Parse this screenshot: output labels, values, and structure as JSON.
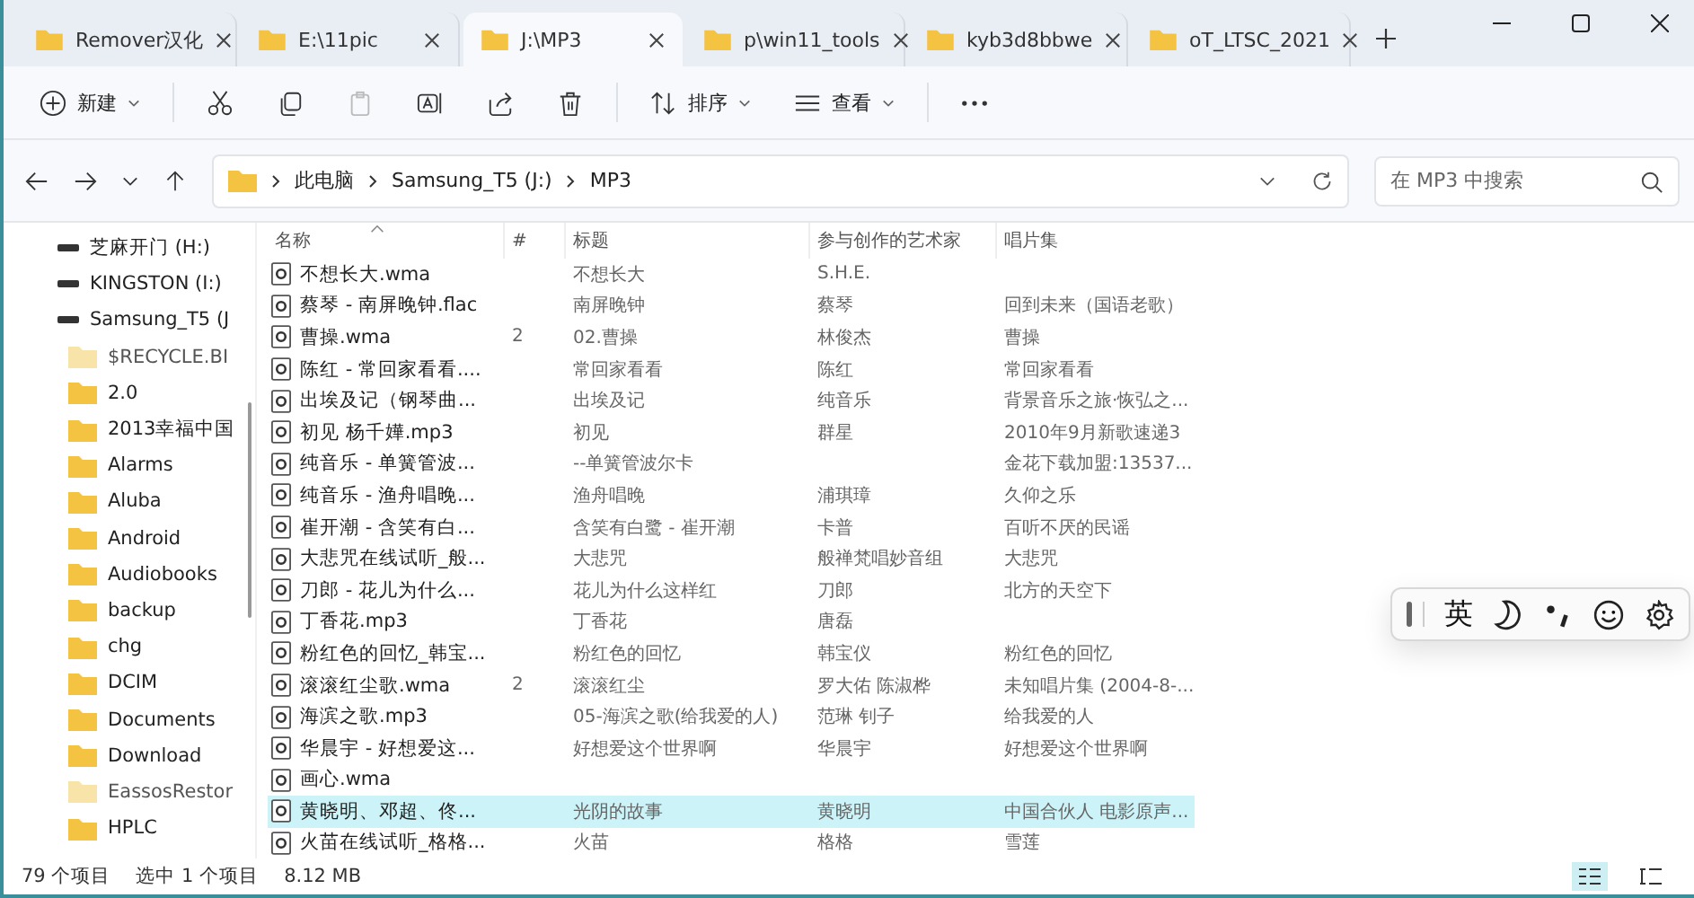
{
  "tabs": [
    {
      "label": "Remover汉化",
      "selected": false
    },
    {
      "label": "E:\\11pic",
      "selected": false
    },
    {
      "label": "J:\\MP3",
      "selected": true
    },
    {
      "label": "p\\win11_tools",
      "selected": false
    },
    {
      "label": "kyb3d8bbwe",
      "selected": false
    },
    {
      "label": "oT_LTSC_2021",
      "selected": false
    }
  ],
  "toolbar": {
    "new_label": "新建",
    "sort_label": "排序",
    "view_label": "查看"
  },
  "breadcrumb": [
    "此电脑",
    "Samsung_T5 (J:)",
    "MP3"
  ],
  "search": {
    "placeholder": "在 MP3 中搜索"
  },
  "sidebar": {
    "items": [
      {
        "label": "芝麻开门 (H:)",
        "kind": "drive",
        "hidden": false
      },
      {
        "label": "KINGSTON (I:)",
        "kind": "drive",
        "hidden": false
      },
      {
        "label": "Samsung_T5 (J",
        "kind": "drive",
        "hidden": false
      },
      {
        "label": "$RECYCLE.BI",
        "kind": "folder",
        "hidden": true
      },
      {
        "label": "2.0",
        "kind": "folder",
        "hidden": false
      },
      {
        "label": "2013幸福中国",
        "kind": "folder",
        "hidden": false
      },
      {
        "label": "Alarms",
        "kind": "folder",
        "hidden": false
      },
      {
        "label": "Aluba",
        "kind": "folder",
        "hidden": false
      },
      {
        "label": "Android",
        "kind": "folder",
        "hidden": false
      },
      {
        "label": "Audiobooks",
        "kind": "folder",
        "hidden": false
      },
      {
        "label": "backup",
        "kind": "folder",
        "hidden": false
      },
      {
        "label": "chg",
        "kind": "folder",
        "hidden": false
      },
      {
        "label": "DCIM",
        "kind": "folder",
        "hidden": false
      },
      {
        "label": "Documents",
        "kind": "folder",
        "hidden": false
      },
      {
        "label": "Download",
        "kind": "folder",
        "hidden": false
      },
      {
        "label": "EassosRestor",
        "kind": "folder",
        "hidden": true
      },
      {
        "label": "HPLC",
        "kind": "folder",
        "hidden": false
      }
    ]
  },
  "table": {
    "columns": [
      "名称",
      "#",
      "标题",
      "参与创作的艺术家",
      "唱片集"
    ],
    "rows": [
      {
        "cells": [
          "不想长大.wma",
          "",
          "不想长大",
          "S.H.E.",
          ""
        ],
        "selected": false
      },
      {
        "cells": [
          "蔡琴 - 南屏晚钟.flac",
          "",
          "南屏晚钟",
          "蔡琴",
          "回到未来（国语老歌）"
        ],
        "selected": false
      },
      {
        "cells": [
          "曹操.wma",
          "2",
          "02.曹操",
          "林俊杰",
          "曹操"
        ],
        "selected": false
      },
      {
        "cells": [
          "陈红 - 常回家看看....",
          "",
          "常回家看看",
          "陈红",
          "常回家看看"
        ],
        "selected": false
      },
      {
        "cells": [
          "出埃及记（钢琴曲...",
          "",
          "出埃及记",
          "纯音乐",
          "背景音乐之旅·恢弘之..."
        ],
        "selected": false
      },
      {
        "cells": [
          "初见 杨千嬅.mp3",
          "",
          "初见",
          "群星",
          "2010年9月新歌速递3"
        ],
        "selected": false
      },
      {
        "cells": [
          "纯音乐 - 单簧管波...",
          "",
          "--单簧管波尔卡",
          "",
          "金花下载加盟:13537..."
        ],
        "selected": false
      },
      {
        "cells": [
          "纯音乐 - 渔舟唱晚...",
          "",
          "渔舟唱晚",
          "浦琪璋",
          "久仰之乐"
        ],
        "selected": false
      },
      {
        "cells": [
          "崔开潮 - 含笑有白...",
          "",
          "含笑有白鹭 - 崔开潮",
          "卡普",
          "百听不厌的民谣"
        ],
        "selected": false
      },
      {
        "cells": [
          "大悲咒在线试听_般...",
          "",
          "大悲咒",
          "般禅梵唱妙音组",
          "大悲咒"
        ],
        "selected": false
      },
      {
        "cells": [
          "刀郎 - 花儿为什么...",
          "",
          "花儿为什么这样红",
          "刀郎",
          "北方的天空下"
        ],
        "selected": false
      },
      {
        "cells": [
          "丁香花.mp3",
          "",
          "丁香花",
          "唐磊",
          ""
        ],
        "selected": false
      },
      {
        "cells": [
          "粉红色的回忆_韩宝...",
          "",
          "粉红色的回忆",
          "韩宝仪",
          "粉红色的回忆"
        ],
        "selected": false
      },
      {
        "cells": [
          "滚滚红尘歌.wma",
          "2",
          "滚滚红尘",
          "罗大佑 陈淑桦",
          "未知唱片集 (2004-8-..."
        ],
        "selected": false
      },
      {
        "cells": [
          "海滨之歌.mp3",
          "",
          "05-海滨之歌(给我爱的人)",
          "范琳 钊子",
          "给我爱的人"
        ],
        "selected": false
      },
      {
        "cells": [
          "华晨宇 - 好想爱这...",
          "",
          "好想爱这个世界啊",
          "华晨宇",
          "好想爱这个世界啊"
        ],
        "selected": false
      },
      {
        "cells": [
          "画心.wma",
          "",
          "",
          "",
          ""
        ],
        "selected": false
      },
      {
        "cells": [
          "黄晓明、邓超、佟...",
          "",
          "光阴的故事",
          "黄晓明",
          "中国合伙人 电影原声..."
        ],
        "selected": true
      },
      {
        "cells": [
          "火苗在线试听_格格...",
          "",
          "火苗",
          "格格",
          "雪莲"
        ],
        "selected": false
      }
    ]
  },
  "ime": {
    "mode_label": "英"
  },
  "status_bar": {
    "count": "79 个项目",
    "selection": "选中 1 个项目",
    "size": "8.12 MB"
  },
  "view_modes": [
    {
      "kind": "details",
      "selected": true
    },
    {
      "kind": "tiles",
      "selected": false
    }
  ]
}
